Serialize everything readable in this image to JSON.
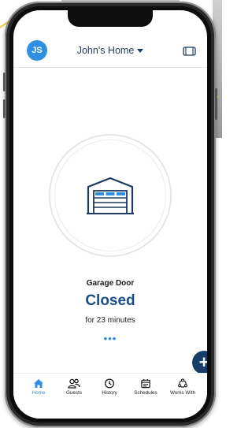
{
  "header": {
    "avatar_initials": "JS",
    "home_name": "John's Home"
  },
  "garage": {
    "name": "Garage Door",
    "status": "Closed",
    "duration": "for 23 minutes",
    "more": "•••"
  },
  "fab": {
    "label": "+"
  },
  "nav": {
    "items": [
      {
        "label": "Home",
        "icon": "home-icon",
        "active": true
      },
      {
        "label": "Guests",
        "icon": "guests-icon",
        "active": false
      },
      {
        "label": "History",
        "icon": "history-icon",
        "active": false
      },
      {
        "label": "Schedules",
        "icon": "calendar-icon",
        "active": false
      },
      {
        "label": "Works With",
        "icon": "works-with-icon",
        "active": false
      }
    ]
  },
  "colors": {
    "accent": "#2f8fe0",
    "status": "#1b4d86",
    "fab": "#173e6b"
  }
}
